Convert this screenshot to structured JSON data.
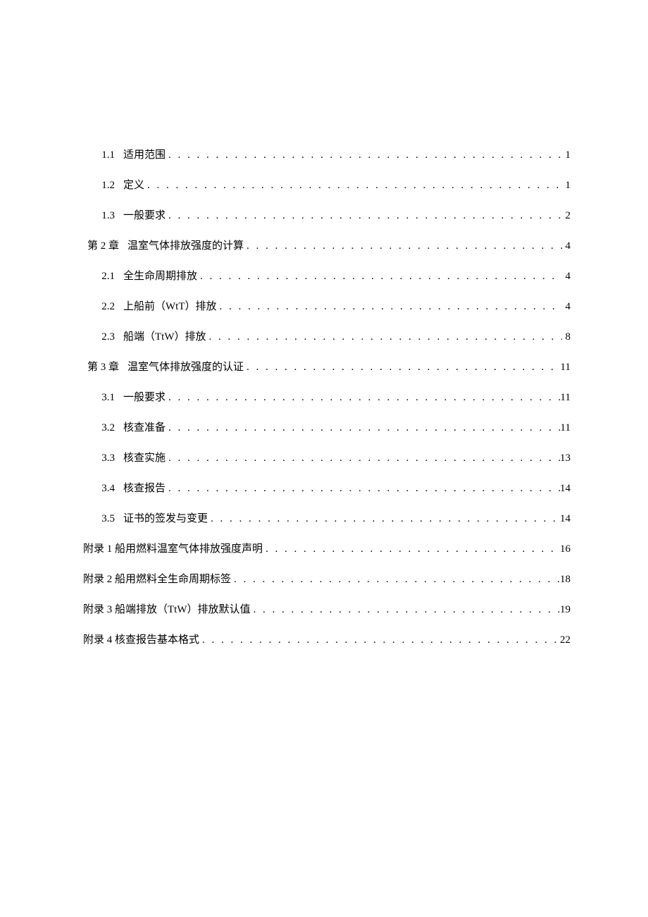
{
  "toc": [
    {
      "type": "sub",
      "num": "1.1",
      "title": "适用范围",
      "page": "1"
    },
    {
      "type": "sub",
      "num": "1.2",
      "title": "定义",
      "page": "1"
    },
    {
      "type": "sub",
      "num": "1.3",
      "title": "一般要求",
      "page": "2"
    },
    {
      "type": "chapter",
      "num": "第 2 章",
      "title": "温室气体排放强度的计算",
      "page": "4"
    },
    {
      "type": "sub",
      "num": "2.1",
      "title": "全生命周期排放",
      "page": "4"
    },
    {
      "type": "sub",
      "num": "2.2",
      "title": "上船前（WtT）排放",
      "page": "4"
    },
    {
      "type": "sub",
      "num": "2.3",
      "title": "船端（TtW）排放",
      "page": "8"
    },
    {
      "type": "chapter",
      "num": "第 3 章",
      "title": "温室气体排放强度的认证",
      "page": "11"
    },
    {
      "type": "sub",
      "num": "3.1",
      "title": "一般要求",
      "page": "11"
    },
    {
      "type": "sub",
      "num": "3.2",
      "title": "核查准备",
      "page": "11"
    },
    {
      "type": "sub",
      "num": "3.3",
      "title": "核查实施",
      "page": "13"
    },
    {
      "type": "sub",
      "num": "3.4",
      "title": "核查报告",
      "page": "14"
    },
    {
      "type": "sub",
      "num": "3.5",
      "title": "证书的签发与变更",
      "page": "14"
    },
    {
      "type": "appendix",
      "num": "",
      "title": "附录 1 船用燃料温室气体排放强度声明",
      "page": "16"
    },
    {
      "type": "appendix",
      "num": "",
      "title": "附录 2 船用燃料全生命周期标签",
      "page": "18"
    },
    {
      "type": "appendix",
      "num": "",
      "title": "附录 3 船端排放（TtW）排放默认值",
      "page": "19"
    },
    {
      "type": "appendix",
      "num": "",
      "title": "附录 4 核查报告基本格式",
      "page": "22"
    }
  ]
}
